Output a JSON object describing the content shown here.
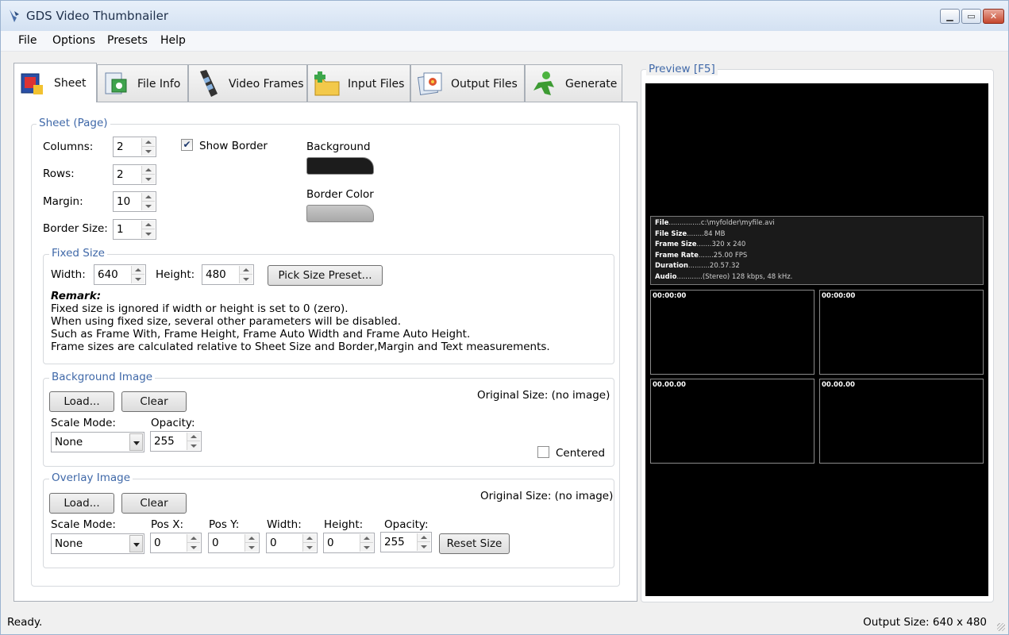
{
  "window": {
    "title": "GDS Video Thumbnailer"
  },
  "menu": [
    "File",
    "Options",
    "Presets",
    "Help"
  ],
  "tabs": [
    {
      "label": "Sheet",
      "icon": "sheet-icon"
    },
    {
      "label": "File Info",
      "icon": "file-info-icon"
    },
    {
      "label": "Video Frames",
      "icon": "film-strip-icon"
    },
    {
      "label": "Input Files",
      "icon": "folder-add-icon"
    },
    {
      "label": "Output Files",
      "icon": "image-stack-icon"
    },
    {
      "label": "Generate",
      "icon": "person-run-icon"
    }
  ],
  "sheet": {
    "group_title": "Sheet (Page)",
    "columns_label": "Columns:",
    "columns": "2",
    "rows_label": "Rows:",
    "rows": "2",
    "margin_label": "Margin:",
    "margin": "10",
    "border_size_label": "Border Size:",
    "border_size": "1",
    "show_border_label": "Show Border",
    "show_border": true,
    "background_label": "Background",
    "background_color": "#1c1c1c",
    "border_color_label": "Border Color",
    "border_color": "#b4b4b4"
  },
  "fixed_size": {
    "group_title": "Fixed Size",
    "width_label": "Width:",
    "width": "640",
    "height_label": "Height:",
    "height": "480",
    "preset_button": "Pick Size Preset...",
    "remark_title": "Remark:",
    "remark_lines": [
      "Fixed size is ignored if width or height is set to 0 (zero).",
      "When using fixed size, several other parameters will be disabled.",
      "Such as Frame With, Frame Height, Frame Auto Width and Frame Auto Height.",
      "Frame sizes are calculated relative to Sheet Size and Border,Margin and Text measurements."
    ]
  },
  "background_image": {
    "group_title": "Background Image",
    "load_button": "Load...",
    "clear_button": "Clear",
    "original_size": "Original Size:  (no image)",
    "scale_mode_label": "Scale Mode:",
    "scale_mode": "None",
    "opacity_label": "Opacity:",
    "opacity": "255",
    "centered_label": "Centered",
    "centered": false
  },
  "overlay_image": {
    "group_title": "Overlay Image",
    "load_button": "Load...",
    "clear_button": "Clear",
    "original_size": "Original Size:  (no image)",
    "scale_mode_label": "Scale Mode:",
    "scale_mode": "None",
    "pos_x_label": "Pos X:",
    "pos_x": "0",
    "pos_y_label": "Pos Y:",
    "pos_y": "0",
    "width_label": "Width:",
    "width": "0",
    "height_label": "Height:",
    "height": "0",
    "opacity_label": "Opacity:",
    "opacity": "255",
    "reset_button": "Reset Size"
  },
  "preview": {
    "title": "Preview  [F5]",
    "info": [
      {
        "key": "File",
        "value": "...............c:\\myfolder\\myfile.avi"
      },
      {
        "key": "File Size",
        "value": "........84 MB"
      },
      {
        "key": "Frame Size",
        "value": ".......320 x 240"
      },
      {
        "key": "Frame Rate",
        "value": ".......25.00 FPS"
      },
      {
        "key": "Duration",
        "value": "..........20.57.32"
      },
      {
        "key": "Audio",
        "value": "............(Stereo) 128 kbps, 48 kHz."
      }
    ],
    "frames": [
      "00:00:00",
      "00:00:00",
      "00.00.00",
      "00.00.00"
    ]
  },
  "status": {
    "left": "Ready.",
    "right": "Output Size: 640 x 480"
  }
}
